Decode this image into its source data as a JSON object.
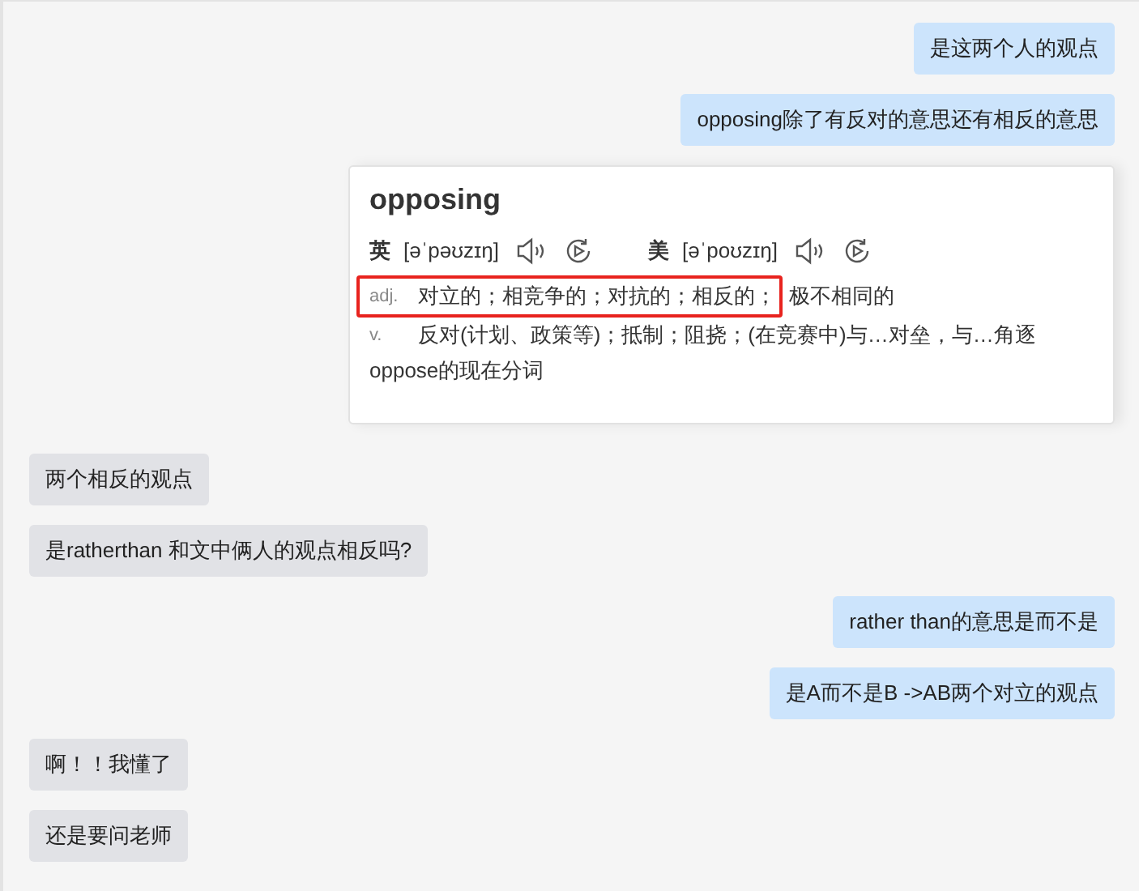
{
  "messages": [
    {
      "kind": "text",
      "sent": true,
      "text": "是这两个人的观点"
    },
    {
      "kind": "text",
      "sent": true,
      "text": "opposing除了有反对的意思还有相反的意思"
    },
    {
      "kind": "dictionary",
      "sent": true,
      "word": "opposing",
      "pronunciations": [
        {
          "region": "英",
          "phonetic": "[əˈpəʊzɪŋ]"
        },
        {
          "region": "美",
          "phonetic": "[əˈpoʊzɪŋ]"
        }
      ],
      "definitions": [
        {
          "pos": "adj.",
          "highlighted": "对立的；相竞争的；对抗的；相反的；",
          "text": "极不相同的"
        },
        {
          "pos": "v.",
          "text": "反对(计划、政策等)；抵制；阻挠；(在竞赛中)与…对垒，与…角逐"
        }
      ],
      "note": "oppose的现在分词"
    },
    {
      "kind": "text",
      "sent": false,
      "text": "两个相反的观点"
    },
    {
      "kind": "text",
      "sent": false,
      "text": "是ratherthan 和文中俩人的观点相反吗?"
    },
    {
      "kind": "text",
      "sent": true,
      "text": "rather than的意思是而不是"
    },
    {
      "kind": "text",
      "sent": true,
      "text": "是A而不是B ->AB两个对立的观点"
    },
    {
      "kind": "text",
      "sent": false,
      "text": "啊！！我懂了"
    },
    {
      "kind": "text",
      "sent": false,
      "text": "还是要问老师"
    }
  ]
}
